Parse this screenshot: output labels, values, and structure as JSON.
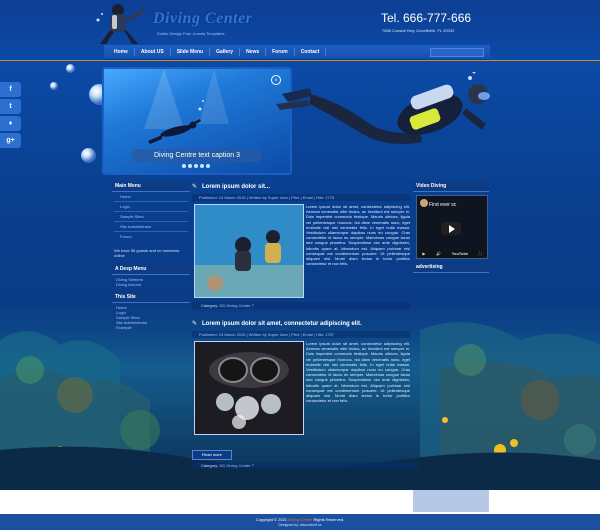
{
  "header": {
    "site_title": "Diving Center",
    "tagline": "Dublin Design Free Joomla Templates",
    "phone": "Tel. 666-777-666",
    "address": "7888 Coastal Hwy, Dovelliville, FL 33333"
  },
  "nav": {
    "items": [
      "Home",
      "About US",
      "Slide Menu",
      "Gallery",
      "News",
      "Forum",
      "Contact"
    ]
  },
  "social": [
    "f",
    "t",
    "♦",
    "g+"
  ],
  "slideshow": {
    "caption": "Diving Centre text caption 3",
    "dots": 5
  },
  "left_sidebar": {
    "main_menu_title": "Main Menu",
    "main_menu": [
      "Home",
      "Login",
      "Sample Sites",
      "Site Administrator",
      "Forum"
    ],
    "online_text": "We have 55 guests and no members online",
    "deep_menu_title": "A Deep Menu",
    "deep_menu": [
      "Diving Seekers",
      "Diving Around"
    ],
    "this_site_title": "This Site",
    "this_site": [
      "Home",
      "Login",
      "Sample Sites",
      "Site Administrator",
      "Example"
    ]
  },
  "articles": [
    {
      "title": "Lorem ipsum dolor sit...",
      "meta": "Published: 24 March 2015  |  Written by Super User  |  Print  |  Email  |  Hits: 1775",
      "body": "Lorem ipsum dolor sit amet, consectetur adipiscing elit. Aenean venenatis nibh lectus, ac tincidunt est semper in. Duis imperdiet commodo tristique. Mauris ultrices, ligula vel pellentesque rhoncus, dui diam venenatis nunc, eget molestie nisl nisl venenatis felis. In eget nulla massa. Vestibulum ullamcorper dapibus nunc eu congue. Cras consectetur id lacus eu semper. Maecenas congue lacus sed congue pharetra. Suspendisse nec ante dignissim, lobortis quam at, bibendum est. Aliquam pulvinar nisl consequat est condimentum posuere. Ut pellentesque aliquam nisl. Morbi diam lectus in tortor porttitor consectetur et non felis.",
      "category_label": "Category:",
      "category": "DD Diving Center 7"
    },
    {
      "title": "Lorem ipsum dolor sit amet, connectetur adipiscing elit.",
      "meta": "Published: 24 March 2015  |  Written by Super User  |  Print  |  Email  |  Hits: 1757",
      "body": "Lorem ipsum dolor sit amet, consectetur adipiscing elit. Aenean venenatis nibh lectus, ac tincidunt est semper in. Duis imperdiet commodo tristique. Mauris ultrices, ligula vel pellentesque rhoncus, dui diam venenatis nunc, eget molestie nisl nisl venenatis felis. In eget nulla massa. Vestibulum ullamcorper dapibus nunc eu congue. Cras consectetur id lacus eu semper. Maecenas congue lacus sed congue pharetra. Suspendisse nec ante dignissim, lobortis quam at, bibendum est. Aliquam pulvinar nisl consequat est condimentum posuere. Ut pellentesque aliquam nisl. Morbi diam lectus in tortor porttitor consectetur et non felis.",
      "read_more": "Read more",
      "category_label": "Category:",
      "category": "DD Diving Center 7"
    }
  ],
  "right_sidebar": {
    "video_title": "Video Diving",
    "video_caption": "First ever sc",
    "video_brand": "YouTube",
    "advertising_title": "advertising"
  },
  "footer": {
    "copyright_prefix": "Copyright © 2021",
    "brand": "Diving Center",
    "copyright_suffix": "Rights Reserved.",
    "designer": "Designed by: www.ddnet.xx"
  },
  "colors": {
    "accent_orange": "#e87722",
    "nav_blue": "#1f5fc4",
    "background_blue": "#0b4aa6"
  }
}
